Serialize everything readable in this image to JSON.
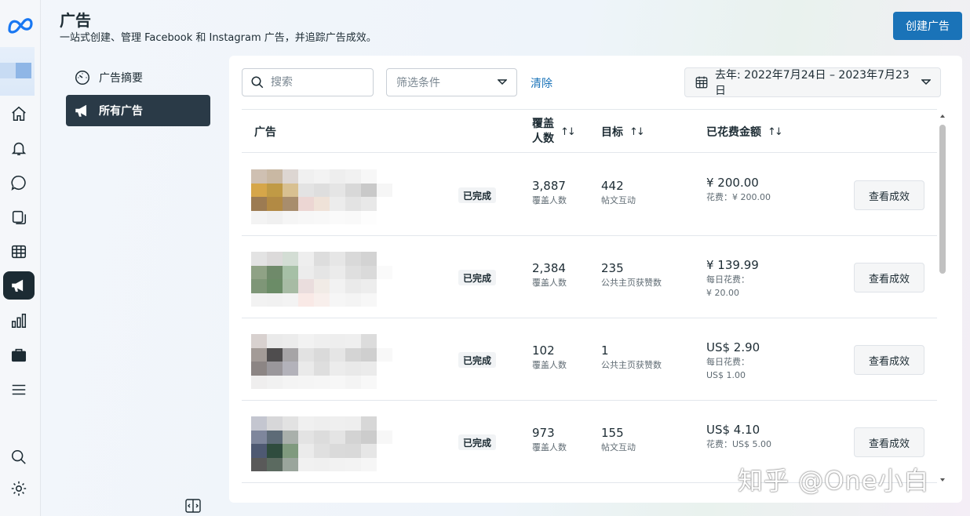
{
  "header": {
    "title": "广告",
    "subtitle": "一站式创建、管理 Facebook 和 Instagram 广告，并追踪广告成效。",
    "create_button": "创建广告"
  },
  "rail": {
    "icons": [
      "meta-logo-icon",
      "home-icon",
      "bell-icon",
      "chat-icon",
      "pages-icon",
      "table-icon",
      "megaphone-icon",
      "bar-chart-icon",
      "briefcase-icon",
      "menu-icon",
      "search-icon",
      "gear-icon"
    ]
  },
  "subnav": {
    "items": [
      {
        "label": "广告摘要",
        "icon": "gauge-icon",
        "active": false
      },
      {
        "label": "所有广告",
        "icon": "megaphone-icon",
        "active": true
      }
    ]
  },
  "toolbar": {
    "search_placeholder": "搜索",
    "filter_placeholder": "筛选条件",
    "clear_label": "清除",
    "date_range": "去年: 2022年7月24日 – 2023年7月23日"
  },
  "table": {
    "headers": {
      "ad": "广告",
      "reach": "覆盖\n人数",
      "goal": "目标",
      "spend": "已花费金额",
      "sort_glyph": "↑↓"
    },
    "rows": [
      {
        "status": "已完成",
        "reach": "3,887",
        "reach_label": "覆盖人数",
        "goal": "442",
        "goal_label": "帖文互动",
        "spend": "¥ 200.00",
        "spend_line1": "花费：¥ 200.00",
        "spend_line2": "",
        "button": "查看成效",
        "thumb": [
          "#cfc0b2",
          "#c9b8a3",
          "#ddd6d2",
          "#f0f0f0",
          "#f3f3f3",
          "#eeeeee",
          "#f1f1f1",
          "#f7f7f7",
          "#ffffff",
          "#d6a649",
          "#c09a45",
          "#d8c091",
          "#e3e3e3",
          "#dedede",
          "#e5e5e5",
          "#d8d8d8",
          "#c9c9c9",
          "#f6f6f6",
          "#9c7b52",
          "#b28a44",
          "#a88d6d",
          "#ecd6d3",
          "#efe2d8",
          "#ececec",
          "#e3e3e3",
          "#e8e8e8",
          "#ffffff",
          "#f3f3f3",
          "#f0f0f0",
          "#f5f5f5",
          "#f7f7f7",
          "#f8f8f8",
          "#fafafa",
          "#f9f9f9",
          "#fdfdfd",
          "#ffffff"
        ]
      },
      {
        "status": "已完成",
        "reach": "2,384",
        "reach_label": "覆盖人数",
        "goal": "235",
        "goal_label": "公共主页获赞数",
        "spend": "¥ 139.99",
        "spend_line1": "每日花费：",
        "spend_line2": "¥ 20.00",
        "button": "查看成效",
        "thumb": [
          "#e3e3e3",
          "#dcdada",
          "#d3ddd4",
          "#eeeeee",
          "#dddddd",
          "#e6e6e6",
          "#d9d9d9",
          "#d3d3d3",
          "#ffffff",
          "#8fa285",
          "#6f8a6a",
          "#a6c0a6",
          "#ececec",
          "#e5e5e5",
          "#ebebeb",
          "#dfdfdf",
          "#dadada",
          "#fafafa",
          "#7e9677",
          "#6b8c67",
          "#a7bba4",
          "#eadddd",
          "#f1ebe6",
          "#f2f2f2",
          "#eaeaea",
          "#ededed",
          "#ffffff",
          "#f2f2f2",
          "#f1f1f1",
          "#f3f3f3",
          "#f9e9e6",
          "#f8efec",
          "#f6f6f6",
          "#f4f4f4",
          "#f7f7f7",
          "#ffffff"
        ]
      },
      {
        "status": "已完成",
        "reach": "102",
        "reach_label": "覆盖人数",
        "goal": "1",
        "goal_label": "公共主页获赞数",
        "spend": "US$ 2.90",
        "spend_line1": "每日花费：",
        "spend_line2": "US$ 1.00",
        "button": "查看成效",
        "thumb": [
          "#d8d1cf",
          "#eaeaea",
          "#ececec",
          "#f2f2f2",
          "#efefef",
          "#eeeeee",
          "#efefef",
          "#dcdcdc",
          "#ffffff",
          "#a39b97",
          "#4f4d4e",
          "#a6a4a6",
          "#e2e2e2",
          "#dadada",
          "#e5e5e5",
          "#d4d4d4",
          "#cfcfcf",
          "#f8f8f8",
          "#8c8584",
          "#9a979b",
          "#b3b2ba",
          "#eaeaea",
          "#dedede",
          "#ececec",
          "#e9e9e9",
          "#ebebeb",
          "#ffffff",
          "#efeeee",
          "#f1f1f1",
          "#f4f4f4",
          "#f5f5f5",
          "#f6f6f6",
          "#f7f7f7",
          "#f4f4f4",
          "#f8f8f8",
          "#ffffff"
        ]
      },
      {
        "status": "已完成",
        "reach": "973",
        "reach_label": "覆盖人数",
        "goal": "155",
        "goal_label": "帖文互动",
        "spend": "US$ 4.10",
        "spend_line1": "花费：US$ 5.00",
        "spend_line2": "",
        "button": "查看成效",
        "thumb": [
          "#c4c6d0",
          "#d7d7d9",
          "#e2e2e2",
          "#f0f0f0",
          "#eeeeee",
          "#efefef",
          "#eeeeee",
          "#d7d7d7",
          "#ffffff",
          "#7e869c",
          "#5d6b77",
          "#a9b0ab",
          "#e3e3e3",
          "#dcdcdc",
          "#e4e4e4",
          "#d3d3d3",
          "#cccccc",
          "#f7f7f7",
          "#4e5972",
          "#2f4c3e",
          "#7f9a7e",
          "#ebebeb",
          "#e0e0e0",
          "#dadada",
          "#d9d9d9",
          "#e6e6e6",
          "#ffffff",
          "#595959",
          "#5b6a60",
          "#9aa59c",
          "#f1f1f1",
          "#f0f0f0",
          "#f2f2f2",
          "#f3f3f3",
          "#f6f6f6",
          "#ffffff"
        ]
      }
    ]
  },
  "colors": {
    "primary": "#1a73b8",
    "dark": "#1c2b33"
  },
  "watermark": "知乎 @One小白"
}
